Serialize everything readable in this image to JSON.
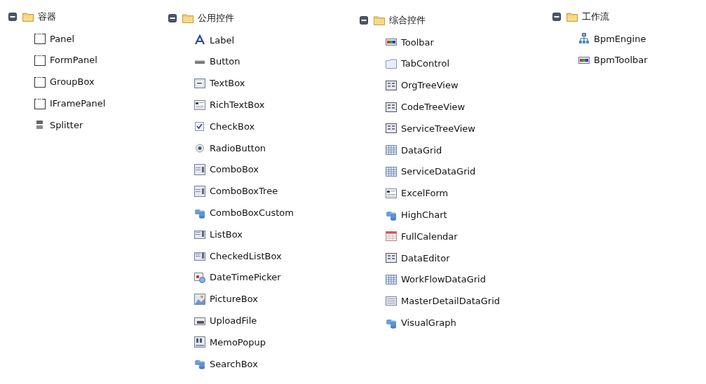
{
  "groups": [
    {
      "label": "容器",
      "expanded": true,
      "children": [
        {
          "label": "Panel",
          "kind": "panel"
        },
        {
          "label": "FormPanel",
          "kind": "panel"
        },
        {
          "label": "GroupBox",
          "kind": "panel"
        },
        {
          "label": "IFramePanel",
          "kind": "panel"
        },
        {
          "label": "Splitter",
          "kind": "splitter"
        }
      ]
    },
    {
      "label": "公用控件",
      "expanded": true,
      "children": [
        {
          "label": "Label",
          "kind": "label"
        },
        {
          "label": "Button",
          "kind": "button"
        },
        {
          "label": "TextBox",
          "kind": "textbox"
        },
        {
          "label": "RichTextBox",
          "kind": "richtext"
        },
        {
          "label": "CheckBox",
          "kind": "checkbox"
        },
        {
          "label": "RadioButton",
          "kind": "radio"
        },
        {
          "label": "ComboBox",
          "kind": "combo"
        },
        {
          "label": "ComboBoxTree",
          "kind": "combo"
        },
        {
          "label": "ComboBoxCustom",
          "kind": "custom"
        },
        {
          "label": "ListBox",
          "kind": "listbox"
        },
        {
          "label": "CheckedListBox",
          "kind": "listbox"
        },
        {
          "label": "DateTimePicker",
          "kind": "datetime"
        },
        {
          "label": "PictureBox",
          "kind": "picture"
        },
        {
          "label": "UploadFile",
          "kind": "upload"
        },
        {
          "label": "MemoPopup",
          "kind": "memo"
        },
        {
          "label": "SearchBox",
          "kind": "custom"
        }
      ]
    },
    {
      "label": "综合控件",
      "expanded": true,
      "children": [
        {
          "label": "Toolbar",
          "kind": "toolbar"
        },
        {
          "label": "TabControl",
          "kind": "tab"
        },
        {
          "label": "OrgTreeView",
          "kind": "tree"
        },
        {
          "label": "CodeTreeView",
          "kind": "tree"
        },
        {
          "label": "ServiceTreeView",
          "kind": "tree"
        },
        {
          "label": "DataGrid",
          "kind": "grid"
        },
        {
          "label": "ServiceDataGrid",
          "kind": "grid"
        },
        {
          "label": "ExcelForm",
          "kind": "richtext"
        },
        {
          "label": "HighChart",
          "kind": "custom"
        },
        {
          "label": "FullCalendar",
          "kind": "calendar"
        },
        {
          "label": "DataEditor",
          "kind": "tree"
        },
        {
          "label": "WorkFlowDataGrid",
          "kind": "grid"
        },
        {
          "label": "MasterDetailDataGrid",
          "kind": "masterdetail"
        },
        {
          "label": "VisualGraph",
          "kind": "custom"
        }
      ]
    },
    {
      "label": "工作流",
      "expanded": true,
      "children": [
        {
          "label": "BpmEngine",
          "kind": "orgchart"
        },
        {
          "label": "BpmToolbar",
          "kind": "toolbar"
        }
      ]
    }
  ]
}
